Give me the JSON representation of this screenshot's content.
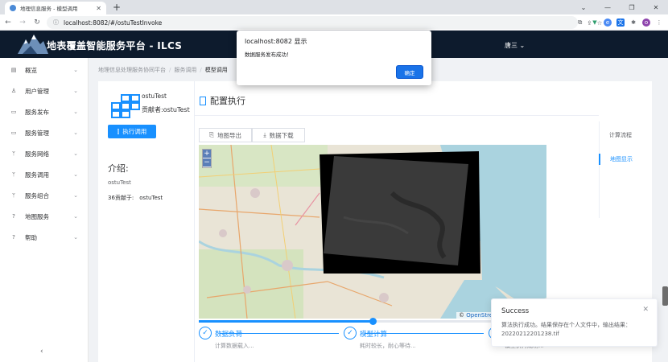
{
  "browser": {
    "tab_title": "地理信息服务 - 模型调用",
    "url": "localhost:8082/#/ostuTestInvoke"
  },
  "app": {
    "title": "地表覆盖智能服务平台 - ILCS",
    "user": "唐三 ⌄"
  },
  "sidebar": {
    "items": [
      {
        "label": "概览",
        "icon": "dashboard-icon"
      },
      {
        "label": "用户管理",
        "icon": "user-icon"
      },
      {
        "label": "服务发布",
        "icon": "monitor-icon"
      },
      {
        "label": "服务管理",
        "icon": "folder-icon"
      },
      {
        "label": "服务网络",
        "icon": "branch-icon"
      },
      {
        "label": "服务调用",
        "icon": "branch-icon"
      },
      {
        "label": "服务组合",
        "icon": "branch-icon"
      },
      {
        "label": "地图服务",
        "icon": "question-icon"
      },
      {
        "label": "帮助",
        "icon": "question-icon"
      }
    ],
    "collapse_icon": "chevron-left-icon"
  },
  "breadcrumb": [
    "地理信息处理服务协同平台",
    "服务调用",
    "模型调用"
  ],
  "service": {
    "name": "ostuTest",
    "author": "贡献者:ostuTest",
    "execute_label": "执行调用",
    "intro_heading": "介绍:",
    "intro_text": "ostuTest",
    "contributor_line": "36贡献于:　ostuTest"
  },
  "config": {
    "title": "配置执行",
    "map_export": "地图导出",
    "data_download": "数据下载",
    "attribution": "OpenStreetMap",
    "slider_progress": 0.5
  },
  "steps": [
    {
      "title": "数据负荷",
      "desc": "计算数据载入..."
    },
    {
      "title": "模型计算",
      "desc": "耗时较长，耐心等待..."
    },
    {
      "title": "",
      "desc": "模型执行成功..."
    }
  ],
  "right_nav": [
    "计算流程",
    "地图显示"
  ],
  "dialog": {
    "title": "localhost:8082 显示",
    "message": "数据服务发布成功！",
    "ok": "确定"
  },
  "notification": {
    "title": "Success",
    "body": "算法执行成功。结果保存在个人文件中，输出结果：20220212201238.tif"
  },
  "colors": {
    "primary": "#1890ff",
    "header_bg": "#0d1b2d",
    "dialog_button": "#1a73e8"
  }
}
